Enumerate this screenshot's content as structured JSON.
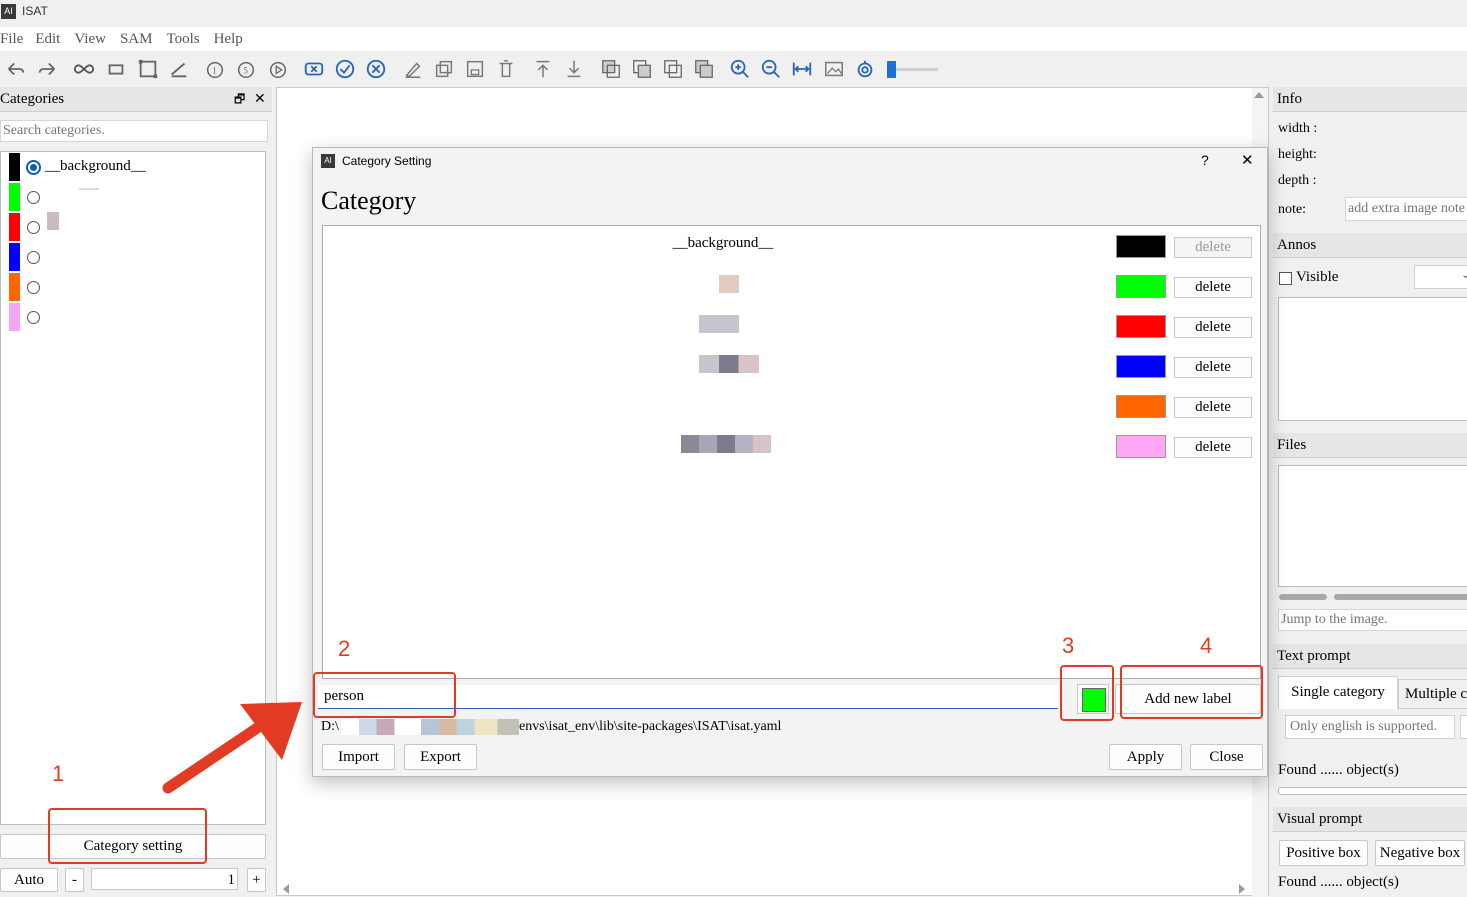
{
  "window": {
    "title": "ISAT",
    "logo": "ISAT-app-icon"
  },
  "menu": [
    "File",
    "Edit",
    "View",
    "SAM",
    "Tools",
    "Help"
  ],
  "categories_panel": {
    "title": "Categories",
    "search_placeholder": "Search categories.",
    "items": [
      {
        "label": "__background__",
        "color": "#000000",
        "selected": true
      },
      {
        "label": "",
        "color": "#00ff00",
        "selected": false
      },
      {
        "label": "",
        "color": "#ff0000",
        "selected": false
      },
      {
        "label": "",
        "color": "#0000ff",
        "selected": false
      },
      {
        "label": "",
        "color": "#ff6600",
        "selected": false
      },
      {
        "label": "",
        "color": "#f5a5f5",
        "selected": false
      }
    ],
    "category_setting_button": "Category setting",
    "auto_button": "Auto",
    "minus_button": "-",
    "plus_button": "+",
    "spin_value": "1"
  },
  "dialog": {
    "window_title": "Category Setting",
    "help": "?",
    "close_x": "✕",
    "heading": "Category",
    "rows": [
      {
        "name": "__background__",
        "color": "#000000",
        "delete": "delete",
        "delete_enabled": false
      },
      {
        "name": "",
        "color": "#00ff00",
        "delete": "delete",
        "delete_enabled": true
      },
      {
        "name": "",
        "color": "#ff0000",
        "delete": "delete",
        "delete_enabled": true
      },
      {
        "name": "",
        "color": "#0000ff",
        "delete": "delete",
        "delete_enabled": true
      },
      {
        "name": "",
        "color": "#ff6600",
        "delete": "delete",
        "delete_enabled": true
      },
      {
        "name": "",
        "color": "#ffa6f5",
        "delete": "delete",
        "delete_enabled": true
      }
    ],
    "new_label_value": "person",
    "new_label_color": "#00ff00",
    "add_new_label": "Add new label",
    "path_prefix": "D:\\",
    "path_suffix": "envs\\isat_env\\lib\\site-packages\\ISAT\\isat.yaml",
    "import": "Import",
    "export": "Export",
    "apply": "Apply",
    "close": "Close"
  },
  "annotations": {
    "n1": "1",
    "n2": "2",
    "n3": "3",
    "n4": "4"
  },
  "info_panel": {
    "title": "Info",
    "width_label": "width :",
    "height_label": "height:",
    "depth_label": "depth :",
    "note_label": "note:",
    "note_placeholder": "add extra image note"
  },
  "annos_panel": {
    "title": "Annos",
    "visible_label": "Visible"
  },
  "files_panel": {
    "title": "Files",
    "jump_placeholder": "Jump to the image."
  },
  "text_prompt": {
    "title": "Text prompt",
    "single_tab": "Single category",
    "multiple_tab": "Multiple c",
    "input_placeholder": "Only english is supported.",
    "found_prefix": "Found",
    "found_dots": "......",
    "found_suffix": "object(s)"
  },
  "visual_prompt": {
    "title": "Visual prompt",
    "positive_box": "Positive box",
    "negative_box": "Negative box",
    "found_prefix": "Found",
    "found_dots": "......",
    "found_suffix": "object(s)"
  },
  "colors": {
    "accent": "#0d5db6",
    "annotation_red": "#e23b24",
    "toolbar_icon": "#2a64b8"
  }
}
